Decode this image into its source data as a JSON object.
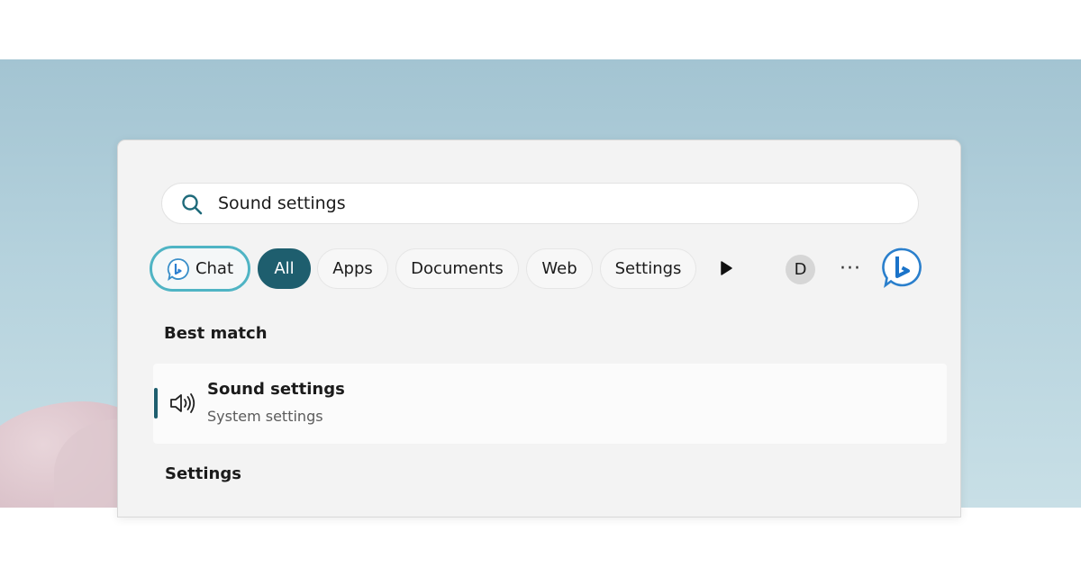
{
  "search": {
    "query": "Sound settings"
  },
  "filters": {
    "chat": "Chat",
    "all": "All",
    "apps": "Apps",
    "documents": "Documents",
    "web": "Web",
    "settings": "Settings",
    "selected": "All"
  },
  "account": {
    "avatar_initial": "D"
  },
  "more": {
    "label": "···"
  },
  "best_match": {
    "heading": "Best match",
    "title": "Sound settings",
    "subtitle": "System settings",
    "icon": "speaker-icon"
  },
  "settings_section": {
    "heading": "Settings"
  },
  "colors": {
    "accent": "#1e5e6e",
    "chat_border": "#4fb4c4",
    "bing_blue": "#1a73c9"
  }
}
